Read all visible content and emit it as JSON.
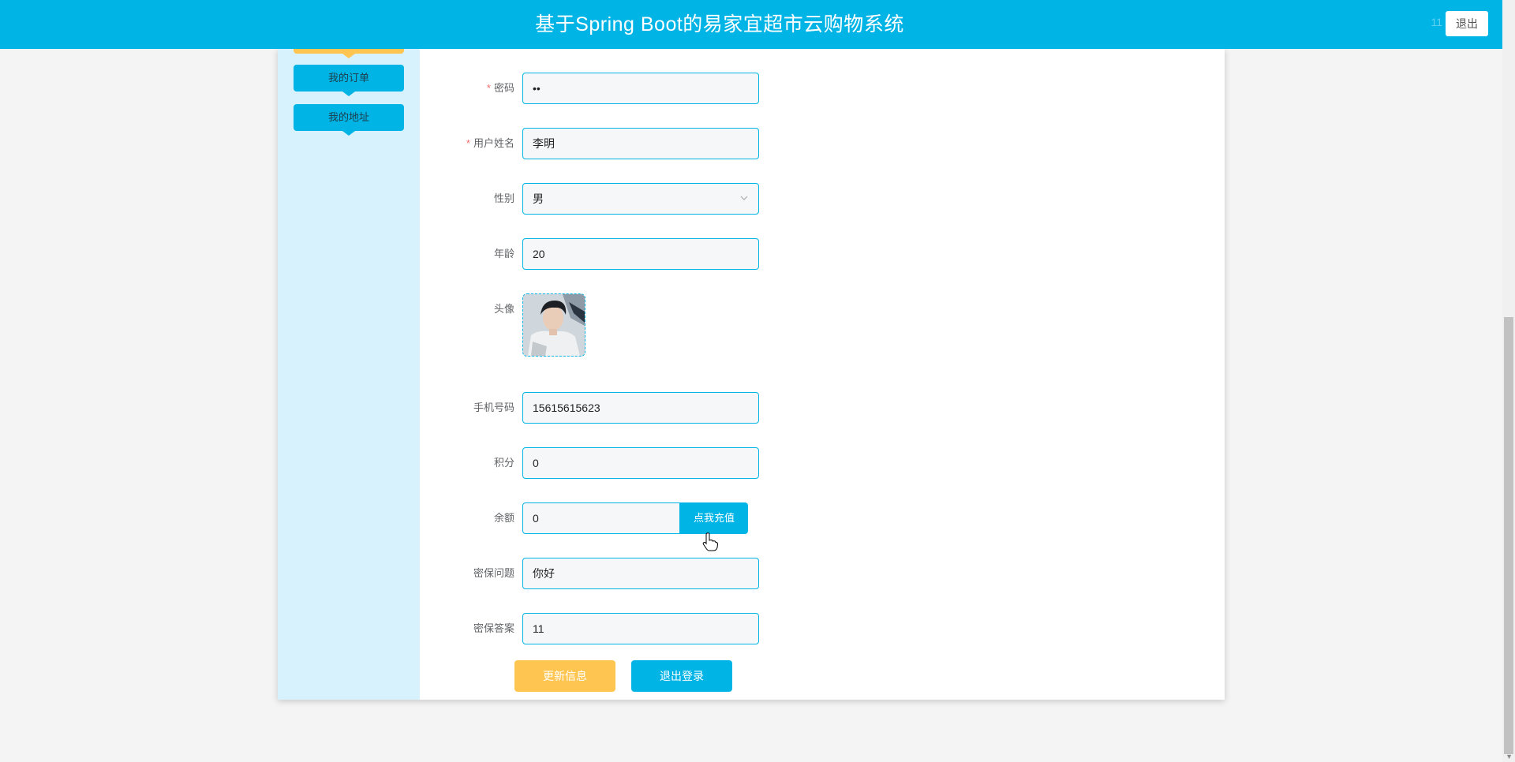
{
  "header": {
    "title": "基于Spring Boot的易家宜超市云购物系统",
    "username": "11",
    "logout_label": "退出"
  },
  "sidebar": {
    "items": [
      {
        "label": "我的订单"
      },
      {
        "label": "我的地址"
      }
    ]
  },
  "form": {
    "password": {
      "label": "密码",
      "value": "••"
    },
    "name": {
      "label": "用户姓名",
      "value": "李明"
    },
    "gender": {
      "label": "性别",
      "value": "男"
    },
    "age": {
      "label": "年龄",
      "value": "20"
    },
    "avatar": {
      "label": "头像"
    },
    "phone": {
      "label": "手机号码",
      "value": "15615615623"
    },
    "points": {
      "label": "积分",
      "value": "0"
    },
    "balance": {
      "label": "余额",
      "value": "0",
      "recharge_label": "点我充值"
    },
    "security_question": {
      "label": "密保问题",
      "value": "你好"
    },
    "security_answer": {
      "label": "密保答案",
      "value": "11"
    },
    "required_mark": "*"
  },
  "actions": {
    "update_label": "更新信息",
    "logout_label": "退出登录"
  },
  "colors": {
    "primary": "#00b4e6",
    "accent": "#ffc551",
    "sidebar_bg": "#d7f2fc",
    "required": "#f56c6c"
  }
}
